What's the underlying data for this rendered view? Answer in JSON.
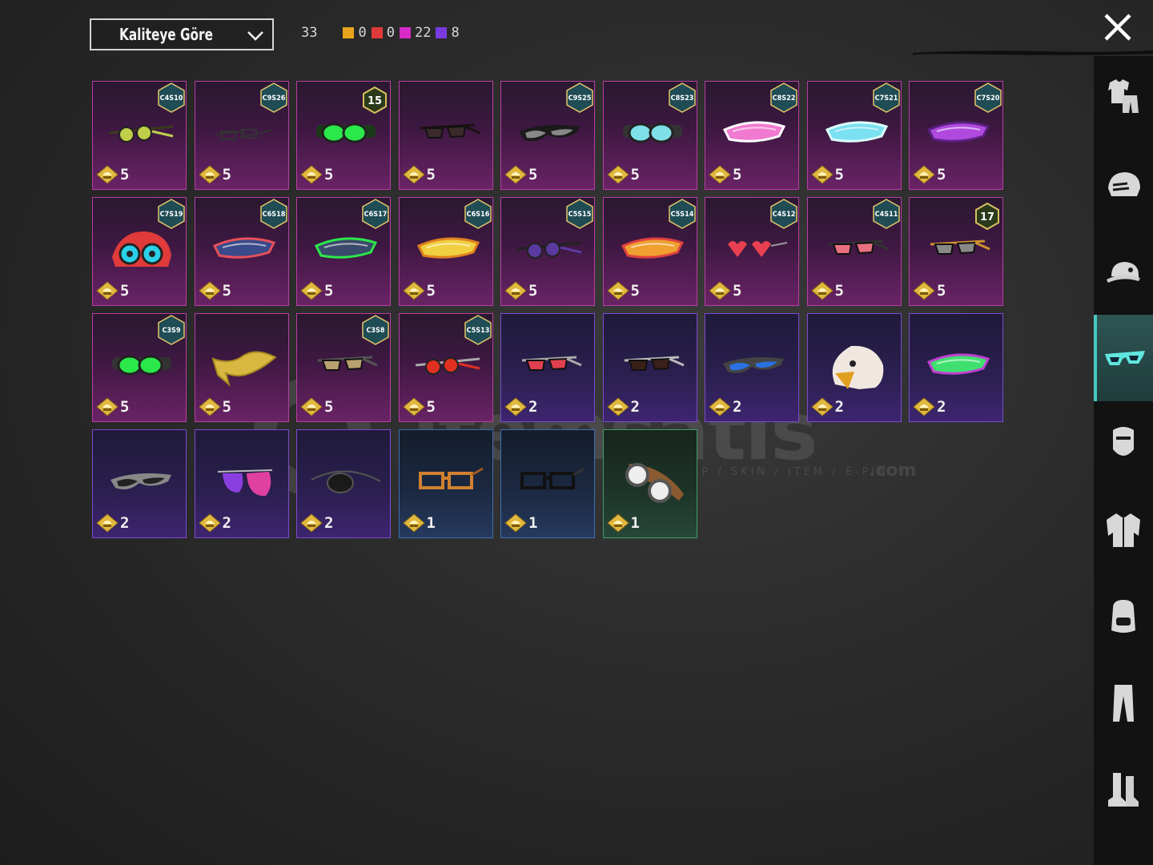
{
  "sort": {
    "label": "Kaliteye Göre"
  },
  "summary": {
    "total": "33",
    "stats": [
      {
        "color": "#e8a51c",
        "count": "0"
      },
      {
        "color": "#e23a3a",
        "count": "0"
      },
      {
        "color": "#d72bc8",
        "count": "22"
      },
      {
        "color": "#7a3ae0",
        "count": "8"
      }
    ]
  },
  "watermark": {
    "brand": "itemsatis",
    "tagline": "HESAP / SKIN / ITEM / E-PIN",
    "domain": ".com"
  },
  "sidebar": [
    {
      "name": "outfit-icon"
    },
    {
      "name": "helmet-icon"
    },
    {
      "name": "cap-icon"
    },
    {
      "name": "glasses-icon",
      "active": true
    },
    {
      "name": "mask-icon"
    },
    {
      "name": "jacket-icon"
    },
    {
      "name": "backpack-icon"
    },
    {
      "name": "pants-icon"
    },
    {
      "name": "boots-icon"
    }
  ],
  "items": [
    {
      "tier": "epic",
      "badge": "C4S10",
      "points": "5",
      "art": "round-sunglasses",
      "colors": [
        "#bfcf4a",
        "#3a3a1a"
      ]
    },
    {
      "tier": "epic",
      "badge": "C9S26",
      "points": "5",
      "art": "thin-glasses",
      "colors": [
        "#333",
        "#111"
      ]
    },
    {
      "tier": "epic",
      "level": "15",
      "points": "5",
      "art": "goggles",
      "colors": [
        "#2be84a",
        "#1a3a1a"
      ]
    },
    {
      "tier": "epic",
      "points": "5",
      "art": "sunglasses",
      "colors": [
        "#3a2a2a",
        "#1a1010"
      ]
    },
    {
      "tier": "epic",
      "badge": "C9S25",
      "points": "5",
      "art": "sport-glasses",
      "colors": [
        "#888",
        "#1a1a1a"
      ]
    },
    {
      "tier": "epic",
      "badge": "C8S23",
      "points": "5",
      "art": "goggles",
      "colors": [
        "#7fdfe8",
        "#333"
      ]
    },
    {
      "tier": "epic",
      "badge": "C8S22",
      "points": "5",
      "art": "visor",
      "colors": [
        "#f07ad0",
        "#ffffff"
      ]
    },
    {
      "tier": "epic",
      "badge": "C7S21",
      "points": "5",
      "art": "visor",
      "colors": [
        "#7ae0f2",
        "#dff"
      ]
    },
    {
      "tier": "epic",
      "badge": "C7S20",
      "points": "5",
      "art": "visor",
      "colors": [
        "#b04adf",
        "#5a2080"
      ]
    },
    {
      "tier": "epic",
      "badge": "C7S19",
      "points": "5",
      "art": "mech-goggles",
      "colors": [
        "#e03a3a",
        "#2ad0e8"
      ]
    },
    {
      "tier": "epic",
      "badge": "C6S18",
      "points": "5",
      "art": "visor",
      "colors": [
        "#3a4a8a",
        "#e8505a"
      ]
    },
    {
      "tier": "epic",
      "badge": "C6S17",
      "points": "5",
      "art": "visor",
      "colors": [
        "#3a4a6a",
        "#2be84a"
      ]
    },
    {
      "tier": "epic",
      "badge": "C6S16",
      "points": "5",
      "art": "visor",
      "colors": [
        "#f0d040",
        "#e08020"
      ]
    },
    {
      "tier": "epic",
      "badge": "C5S15",
      "points": "5",
      "art": "round-sunglasses",
      "colors": [
        "#5a3aa0",
        "#222"
      ]
    },
    {
      "tier": "epic",
      "badge": "C5S14",
      "points": "5",
      "art": "visor",
      "colors": [
        "#f0a030",
        "#e04040"
      ]
    },
    {
      "tier": "epic",
      "badge": "C4S12",
      "points": "5",
      "art": "heart-glasses",
      "colors": [
        "#e84050",
        "#999"
      ]
    },
    {
      "tier": "epic",
      "badge": "C4S11",
      "points": "5",
      "art": "sunglasses",
      "colors": [
        "#e87080",
        "#333"
      ]
    },
    {
      "tier": "epic",
      "level": "17",
      "points": "5",
      "art": "sunglasses",
      "colors": [
        "#888",
        "#d09030"
      ]
    },
    {
      "tier": "epic",
      "badge": "C3S9",
      "points": "5",
      "art": "goggles",
      "colors": [
        "#2be84a",
        "#333"
      ]
    },
    {
      "tier": "epic",
      "points": "5",
      "art": "ribbon-mask",
      "colors": [
        "#d8b840",
        "#a88a20"
      ]
    },
    {
      "tier": "epic",
      "badge": "C3S8",
      "points": "5",
      "art": "sunglasses",
      "colors": [
        "#b8a070",
        "#555"
      ]
    },
    {
      "tier": "epic",
      "badge": "C5S13",
      "points": "5",
      "art": "round-sunglasses",
      "colors": [
        "#e03020",
        "#aaa"
      ]
    },
    {
      "tier": "purple",
      "points": "2",
      "art": "sunglasses",
      "colors": [
        "#e04050",
        "#aaa"
      ]
    },
    {
      "tier": "purple",
      "points": "2",
      "art": "sunglasses",
      "colors": [
        "#3a2018",
        "#bbb"
      ]
    },
    {
      "tier": "purple",
      "points": "2",
      "art": "sport-glasses",
      "colors": [
        "#2a70e0",
        "#444"
      ]
    },
    {
      "tier": "purple",
      "points": "2",
      "art": "eagle-mask",
      "colors": [
        "#f0e8e0",
        "#e0a020"
      ]
    },
    {
      "tier": "purple",
      "points": "2",
      "art": "visor",
      "colors": [
        "#40e070",
        "#c040d0"
      ]
    },
    {
      "tier": "purple",
      "points": "2",
      "art": "sport-glasses",
      "colors": [
        "#222",
        "#888"
      ]
    },
    {
      "tier": "purple",
      "points": "2",
      "art": "aviator",
      "colors": [
        "#8a40e0",
        "#e040a0"
      ]
    },
    {
      "tier": "purple",
      "points": "2",
      "art": "eyepatch",
      "colors": [
        "#1a1a1a",
        "#555"
      ]
    },
    {
      "tier": "blue",
      "points": "1",
      "art": "rect-glasses",
      "colors": [
        "#d08030",
        "#a05a20"
      ]
    },
    {
      "tier": "blue",
      "points": "1",
      "art": "rect-glasses",
      "colors": [
        "#111",
        "#333"
      ]
    },
    {
      "tier": "green",
      "points": "1",
      "art": "pilot-goggles",
      "colors": [
        "#ccc",
        "#8a5a30"
      ]
    }
  ]
}
